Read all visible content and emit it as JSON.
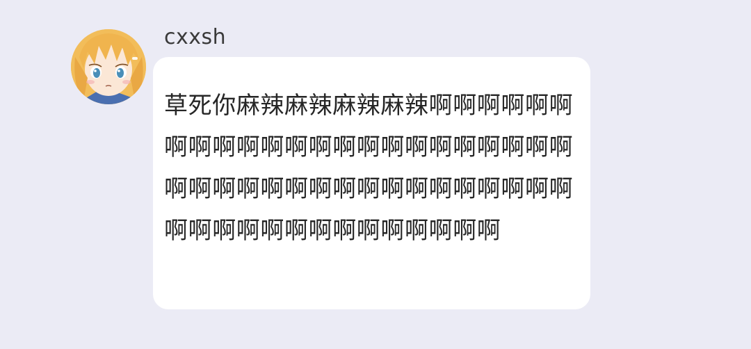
{
  "chat": {
    "message": {
      "sender": {
        "name": "cxxsh",
        "avatar_icon": "anime-character-avatar"
      },
      "text": "草死你麻辣麻辣麻辣麻辣啊啊啊啊啊啊啊啊啊啊啊啊啊啊啊啊啊啊啊啊啊啊啊啊啊啊啊啊啊啊啊啊啊啊啊啊啊啊啊啊啊啊啊啊啊啊啊啊啊啊啊啊啊啊"
    }
  },
  "theme": {
    "background": "#ebebf5",
    "bubble": "#ffffff",
    "text": "#262626"
  }
}
